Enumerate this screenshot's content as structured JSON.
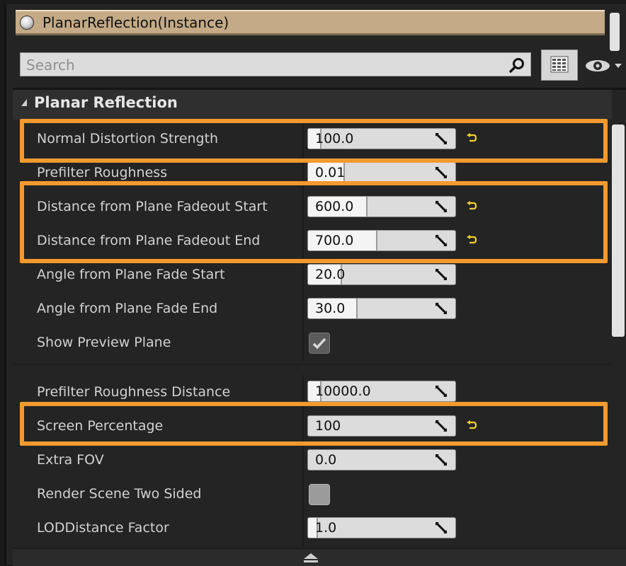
{
  "object_bar": {
    "title": "PlanarReflection(Instance)",
    "icon": "sphere-icon"
  },
  "search": {
    "placeholder": "Search",
    "icon": "search-icon"
  },
  "toolbar": {
    "view_options_icon": "grid-view-icon",
    "visibility_icon": "eye-icon"
  },
  "category": {
    "title": "Planar Reflection",
    "icon": "collapse-arrow-icon"
  },
  "properties": [
    {
      "label": "Normal Distortion Strength",
      "value": "100.0",
      "fill_fraction": 0.08,
      "reset": true,
      "highlighted": true
    },
    {
      "label": "Prefilter Roughness",
      "value": "0.01",
      "fill_fraction": 0.22,
      "reset": false,
      "highlighted": false
    },
    {
      "label": "Distance from Plane Fadeout Start",
      "value": "600.0",
      "fill_fraction": 0.38,
      "reset": true,
      "highlighted": true
    },
    {
      "label": "Distance from Plane Fadeout End",
      "value": "700.0",
      "fill_fraction": 0.46,
      "reset": true,
      "highlighted": true
    },
    {
      "label": "Angle from Plane Fade Start",
      "value": "20.0",
      "fill_fraction": 0.22,
      "reset": false,
      "highlighted": false
    },
    {
      "label": "Angle from Plane Fade End",
      "value": "30.0",
      "fill_fraction": 0.33,
      "reset": false,
      "highlighted": false
    },
    {
      "label": "Show Preview Plane",
      "checked": true
    },
    {
      "label": "Prefilter Roughness Distance",
      "value": "10000.0",
      "fill_fraction": 0.08,
      "reset": false,
      "highlighted": false
    },
    {
      "label": "Screen Percentage",
      "value": "100",
      "fill_fraction": 0.0,
      "reset": true,
      "highlighted": true
    },
    {
      "label": "Extra FOV",
      "value": "0.0",
      "fill_fraction": 0.0,
      "reset": false,
      "highlighted": false
    },
    {
      "label": "Render Scene Two Sided",
      "checked": false
    },
    {
      "label": "LODDistance Factor",
      "value": "1.0",
      "fill_fraction": 0.05,
      "reset": false,
      "highlighted": false
    }
  ],
  "colors": {
    "highlight": "#f39a2f",
    "reset_arrow": "#f0d030",
    "panel": "#242424"
  }
}
